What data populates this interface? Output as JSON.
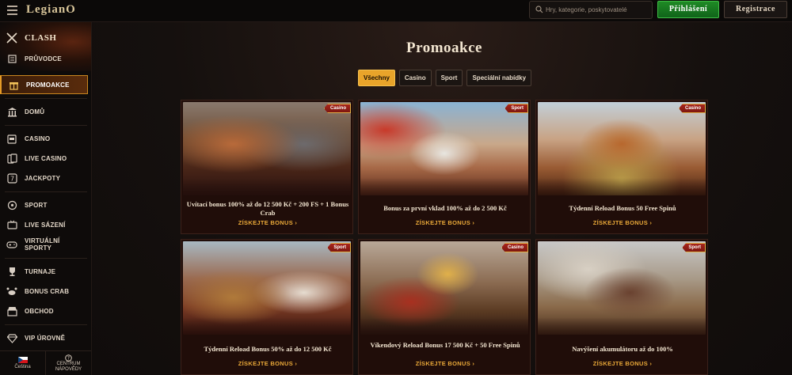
{
  "topbar": {
    "logo_text": "LegianO",
    "search_placeholder": "Hry, kategorie, poskytovatelé",
    "login_label": "Přihlášení",
    "register_label": "Registrace"
  },
  "sidebar": {
    "clash_label": "CLASH",
    "items": [
      {
        "label": "PRŮVODCE",
        "icon": "scroll-icon"
      },
      {
        "label": "PROMOAKCE",
        "icon": "gift-icon"
      },
      {
        "label": "DOMŮ",
        "icon": "temple-icon"
      },
      {
        "label": "CASINO",
        "icon": "slot-machine-icon"
      },
      {
        "label": "LIVE CASINO",
        "icon": "cards-icon"
      },
      {
        "label": "JACKPOTY",
        "icon": "jackpot-icon"
      },
      {
        "label": "SPORT",
        "icon": "soccer-ball-icon"
      },
      {
        "label": "LIVE SÁZENÍ",
        "icon": "live-tv-icon"
      },
      {
        "label": "VIRTUÁLNÍ SPORTY",
        "icon": "gamepad-icon"
      },
      {
        "label": "TURNAJE",
        "icon": "trophy-icon"
      },
      {
        "label": "BONUS CRAB",
        "icon": "crab-icon"
      },
      {
        "label": "OBCHOD",
        "icon": "shop-icon"
      },
      {
        "label": "VIP ÚROVNĚ",
        "icon": "diamond-icon"
      }
    ],
    "language_label": "Čeština",
    "help_label_1": "CENTRUM",
    "help_label_2": "NÁPOVĚDY"
  },
  "main": {
    "title": "Promoakce",
    "filters": [
      {
        "label": "Všechny",
        "active": true
      },
      {
        "label": "Casino",
        "active": false
      },
      {
        "label": "Sport",
        "active": false
      },
      {
        "label": "Speciální nabídky",
        "active": false
      }
    ],
    "cards": [
      {
        "badge": "Casino",
        "title": "Uvítací bonus 100% až do 12 500 Kč + 200 FS + 1 Bonus Crab",
        "cta": "ZÍSKEJTE BONUS"
      },
      {
        "badge": "Sport",
        "title": "Bonus za první vklad 100% až do 2 500 Kč",
        "cta": "ZÍSKEJTE BONUS"
      },
      {
        "badge": "Casino",
        "title": "Týdenní Reload Bonus 50 Free Spinů",
        "cta": "ZÍSKEJTE BONUS"
      },
      {
        "badge": "Sport",
        "title": "Týdenní Reload Bonus 50% až do 12 500 Kč",
        "cta": "ZÍSKEJTE BONUS"
      },
      {
        "badge": "Casino",
        "title": "Víkendový Reload Bonus 17 500 Kč + 50 Free Spinů",
        "cta": "ZÍSKEJTE BONUS"
      },
      {
        "badge": "Sport",
        "title": "Navýšení akumulátoru až do 100%",
        "cta": "ZÍSKEJTE BONUS"
      }
    ]
  },
  "colors": {
    "accent_gold": "#e9a42a",
    "login_green": "#1f8a25",
    "badge_red": "#a8261c",
    "background": "#0f0b0a"
  }
}
